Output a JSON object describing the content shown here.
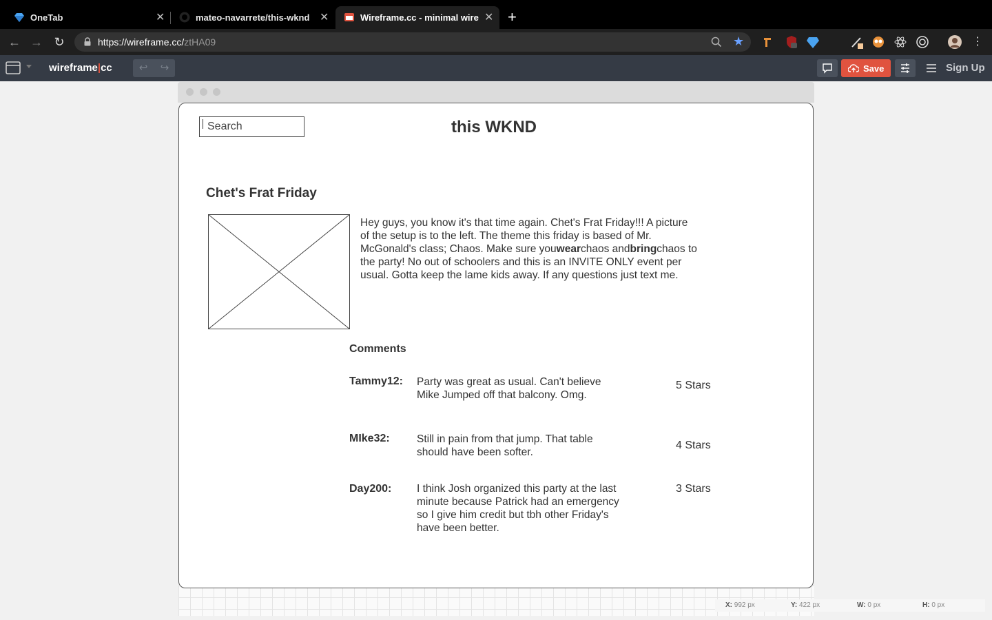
{
  "browser": {
    "tabs": [
      {
        "title": "OneTab",
        "icon": "onetab-diamond-icon",
        "active": false
      },
      {
        "title": "mateo-navarrete/this-wknd",
        "icon": "github-icon",
        "active": false
      },
      {
        "title": "Wireframe.cc - minimal wirefra",
        "icon": "wireframe-cc-icon",
        "active": true
      }
    ],
    "url_host": "https://wireframe.cc/",
    "url_path": "ztHA09"
  },
  "app": {
    "brand_left": "wireframe",
    "brand_sep": "|",
    "brand_right": "cc",
    "save_label": "Save",
    "signup_label": "Sign Up",
    "accent_color": "#e0533f"
  },
  "wireframe": {
    "search_placeholder": "Search",
    "site_title": "this WKND",
    "post_title": "Chet's Frat Friday",
    "post_body": {
      "p1": "Hey guys, you know it's that time again. Chet's Frat Friday!!! A picture of the setup is to the left. The theme this friday is based of Mr. McGonald's class; Chaos. Make sure you",
      "b1": "wear",
      "p2": "chaos and",
      "b2": "bring",
      "p3": "chaos to the party! No out of schoolers and this is an INVITE ONLY event per usual. Gotta keep the lame kids away. If any questions just text me."
    },
    "comments_heading": "Comments",
    "comments": [
      {
        "user": "Tammy12:",
        "text": "Party was great as usual. Can't believe Mike Jumped off that balcony. Omg.",
        "rating": "5 Stars"
      },
      {
        "user": "MIke32:",
        "text": "Still in pain from that jump. That table should have been softer.",
        "rating": "4 Stars"
      },
      {
        "user": "Day200:",
        "text": "I think Josh organized this party at the last minute because Patrick had an emergency so I give him credit but tbh other Friday's have been better.",
        "rating": "3 Stars"
      }
    ]
  },
  "status": {
    "x_label": "X:",
    "x_value": "992 px",
    "y_label": "Y:",
    "y_value": "422 px",
    "w_label": "W:",
    "w_value": "0 px",
    "h_label": "H:",
    "h_value": "0 px"
  }
}
